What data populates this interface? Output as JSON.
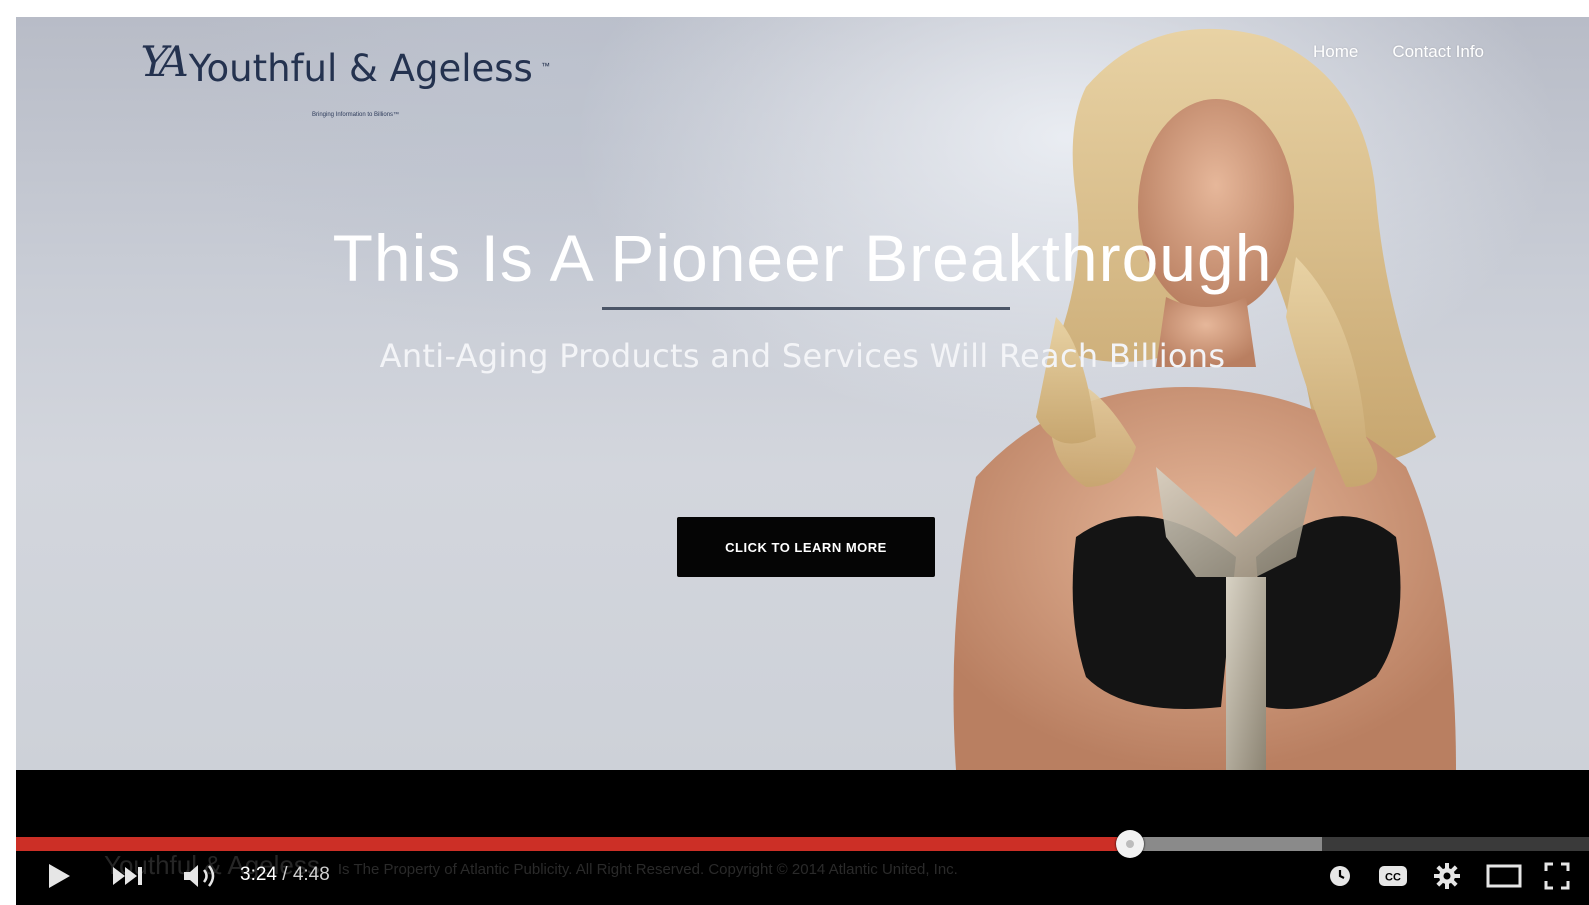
{
  "site": {
    "logo_mark": "YA",
    "logo_text": "Youthful & Ageless",
    "logo_tm": "™",
    "logo_tagline": "Bringing Information to Billions™",
    "nav": [
      "Home",
      "Contact Info"
    ]
  },
  "hero": {
    "headline": "This Is A Pioneer Breakthrough",
    "subheadline": "Anti-Aging Products and Services Will Reach Billions",
    "cta_label": "CLICK TO LEARN MORE"
  },
  "player": {
    "current_time": "3:24",
    "separator": " / ",
    "duration": "4:48",
    "played_fraction": 0.708,
    "buffered_fraction": 0.83,
    "overlay_caption_brand": "Youthful & Ageless",
    "overlay_caption_text": "Is The Property of Atlantic Publicity. All Right Reserved. Copyright © 2014 Atlantic United, Inc.",
    "colors": {
      "played": "#cc2f26",
      "buffered": "#8a8a8a"
    },
    "icons": [
      "play-icon",
      "next-icon",
      "volume-icon",
      "watch-later-icon",
      "captions-icon",
      "settings-icon",
      "theater-mode-icon",
      "fullscreen-icon"
    ]
  }
}
